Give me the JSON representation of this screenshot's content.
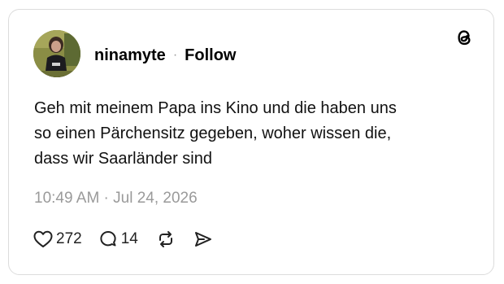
{
  "post": {
    "author": {
      "username": "ninamyte",
      "separator": "·",
      "follow_label": "Follow"
    },
    "text": "Geh mit meinem Papa ins Kino und die haben uns\nso einen Pärchensitz gegeben, woher wissen die,\ndass wir Saarländer sind",
    "timestamp": "10:49 AM · Jul 24, 2026",
    "stats": {
      "likes": "272",
      "replies": "14"
    }
  },
  "icons": {
    "logo": "threads-logo-icon",
    "like": "heart-icon",
    "reply": "speech-bubble-icon",
    "repost": "repost-icon",
    "share": "send-icon"
  },
  "colors": {
    "border": "#dcdcdc",
    "timestamp": "#9a9a9a",
    "text": "#111111"
  }
}
